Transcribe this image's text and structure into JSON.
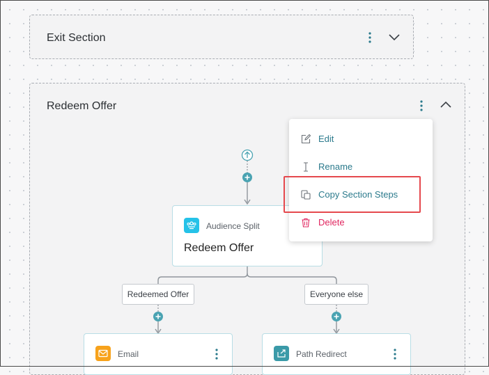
{
  "sections": {
    "exit": {
      "title": "Exit Section"
    },
    "redeem": {
      "title": "Redeem Offer"
    }
  },
  "menu": {
    "items": [
      {
        "label": "Edit",
        "icon": "edit-icon"
      },
      {
        "label": "Rename",
        "icon": "text-cursor-icon"
      },
      {
        "label": "Copy Section Steps",
        "icon": "copy-icon"
      },
      {
        "label": "Delete",
        "icon": "trash-icon"
      }
    ]
  },
  "flow": {
    "split_node": {
      "type": "Audience Split",
      "name": "Redeem Offer"
    },
    "branches": [
      {
        "label": "Redeemed Offer"
      },
      {
        "label": "Everyone else"
      }
    ],
    "email_node": {
      "type": "Email"
    },
    "redirect_node": {
      "type": "Path Redirect"
    }
  },
  "colors": {
    "teal": "#4aa3b2",
    "menu_text": "#2b7a8c",
    "delete": "#e0245e",
    "highlight": "#e5484d",
    "split_icon": "#25c2e8",
    "email_icon": "#f7a21b",
    "redirect_icon": "#3a9aa8"
  }
}
